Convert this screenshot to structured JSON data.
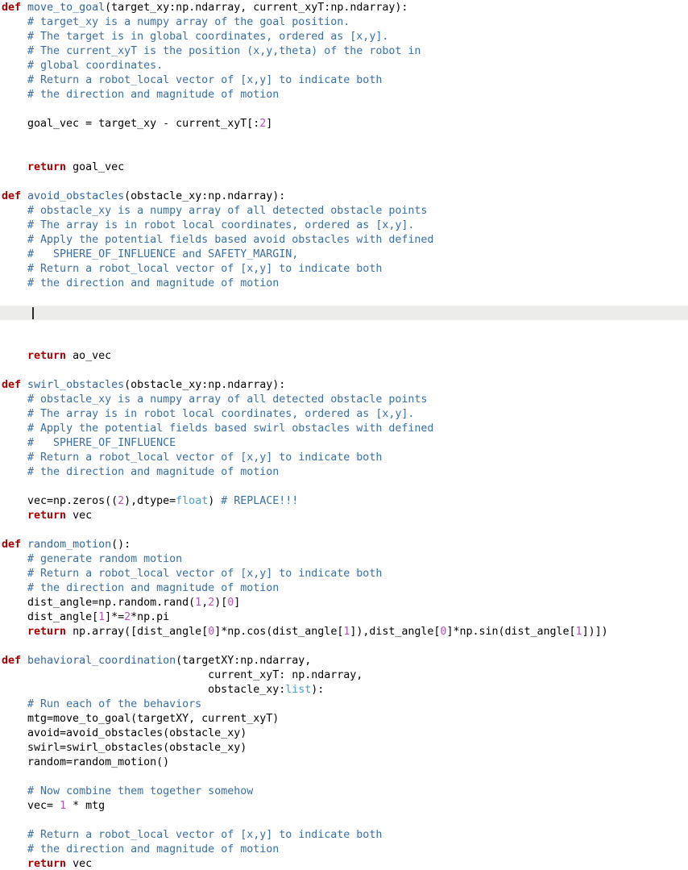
{
  "editor": {
    "name": "python-code-editor",
    "background_color": "#ffffff",
    "current_line_highlight_color": "#ececea",
    "caret_color": "#2b2b2b",
    "font_size_px": 13.3,
    "line_height_px": 18,
    "language": "python"
  },
  "colors": {
    "keyword": "#aa0000",
    "function_name": "#3465a4",
    "builtin_type": "#4e9bd6",
    "number": "#b452b4",
    "comment": "#3b6ea5",
    "plain": "#000000"
  },
  "caret": {
    "line_index": 21,
    "column": 4
  },
  "lines": [
    {
      "i": 0,
      "tokens": [
        {
          "t": "def",
          "c": "kw"
        },
        {
          "t": " ",
          "c": "plain"
        },
        {
          "t": "move_to_goal",
          "c": "fn"
        },
        {
          "t": "(target_xy:np.ndarray, current_xyT:np.ndarray):",
          "c": "plain"
        }
      ]
    },
    {
      "i": 1,
      "tokens": [
        {
          "t": "    ",
          "c": "plain"
        },
        {
          "t": "# target_xy is a numpy array of the goal position.",
          "c": "com"
        }
      ]
    },
    {
      "i": 2,
      "tokens": [
        {
          "t": "    ",
          "c": "plain"
        },
        {
          "t": "# The target is in global coordinates, ordered as [x,y].",
          "c": "com"
        }
      ]
    },
    {
      "i": 3,
      "tokens": [
        {
          "t": "    ",
          "c": "plain"
        },
        {
          "t": "# The current_xyT is the position (x,y,theta) of the robot in",
          "c": "com"
        }
      ]
    },
    {
      "i": 4,
      "tokens": [
        {
          "t": "    ",
          "c": "plain"
        },
        {
          "t": "# global coordinates.",
          "c": "com"
        }
      ]
    },
    {
      "i": 5,
      "tokens": [
        {
          "t": "    ",
          "c": "plain"
        },
        {
          "t": "# Return a robot_local vector of [x,y] to indicate both",
          "c": "com"
        }
      ]
    },
    {
      "i": 6,
      "tokens": [
        {
          "t": "    ",
          "c": "plain"
        },
        {
          "t": "# the direction and magnitude of motion",
          "c": "com"
        }
      ]
    },
    {
      "i": 7,
      "tokens": []
    },
    {
      "i": 8,
      "tokens": [
        {
          "t": "    goal_vec = target_xy - current_xyT[:",
          "c": "plain"
        },
        {
          "t": "2",
          "c": "num"
        },
        {
          "t": "]",
          "c": "plain"
        }
      ]
    },
    {
      "i": 9,
      "tokens": []
    },
    {
      "i": 10,
      "tokens": []
    },
    {
      "i": 11,
      "tokens": [
        {
          "t": "    ",
          "c": "plain"
        },
        {
          "t": "return",
          "c": "kw"
        },
        {
          "t": " goal_vec",
          "c": "plain"
        }
      ]
    },
    {
      "i": 12,
      "tokens": []
    },
    {
      "i": 13,
      "tokens": [
        {
          "t": "def",
          "c": "kw"
        },
        {
          "t": " ",
          "c": "plain"
        },
        {
          "t": "avoid_obstacles",
          "c": "fn"
        },
        {
          "t": "(obstacle_xy:np.ndarray):",
          "c": "plain"
        }
      ]
    },
    {
      "i": 14,
      "tokens": [
        {
          "t": "    ",
          "c": "plain"
        },
        {
          "t": "# obstacle_xy is a numpy array of all detected obstacle points",
          "c": "com"
        }
      ]
    },
    {
      "i": 15,
      "tokens": [
        {
          "t": "    ",
          "c": "plain"
        },
        {
          "t": "# The array is in robot local coordinates, ordered as [x,y].",
          "c": "com"
        }
      ]
    },
    {
      "i": 16,
      "tokens": [
        {
          "t": "    ",
          "c": "plain"
        },
        {
          "t": "# Apply the potential fields based avoid obstacles with defined",
          "c": "com"
        }
      ]
    },
    {
      "i": 17,
      "tokens": [
        {
          "t": "    ",
          "c": "plain"
        },
        {
          "t": "#   SPHERE_OF_INFLUENCE and SAFETY_MARGIN,",
          "c": "com"
        }
      ]
    },
    {
      "i": 18,
      "tokens": [
        {
          "t": "    ",
          "c": "plain"
        },
        {
          "t": "# Return a robot_local vector of [x,y] to indicate both",
          "c": "com"
        }
      ]
    },
    {
      "i": 19,
      "tokens": [
        {
          "t": "    ",
          "c": "plain"
        },
        {
          "t": "# the direction and magnitude of motion",
          "c": "com"
        }
      ]
    },
    {
      "i": 20,
      "tokens": []
    },
    {
      "i": 21,
      "tokens": [
        {
          "t": "    ",
          "c": "plain"
        }
      ],
      "current": true
    },
    {
      "i": 22,
      "tokens": []
    },
    {
      "i": 23,
      "tokens": []
    },
    {
      "i": 24,
      "tokens": [
        {
          "t": "    ",
          "c": "plain"
        },
        {
          "t": "return",
          "c": "kw"
        },
        {
          "t": " ao_vec",
          "c": "plain"
        }
      ]
    },
    {
      "i": 25,
      "tokens": []
    },
    {
      "i": 26,
      "tokens": [
        {
          "t": "def",
          "c": "kw"
        },
        {
          "t": " ",
          "c": "plain"
        },
        {
          "t": "swirl_obstacles",
          "c": "fn"
        },
        {
          "t": "(obstacle_xy:np.ndarray):",
          "c": "plain"
        }
      ]
    },
    {
      "i": 27,
      "tokens": [
        {
          "t": "    ",
          "c": "plain"
        },
        {
          "t": "# obstacle_xy is a numpy array of all detected obstacle points",
          "c": "com"
        }
      ]
    },
    {
      "i": 28,
      "tokens": [
        {
          "t": "    ",
          "c": "plain"
        },
        {
          "t": "# The array is in robot local coordinates, ordered as [x,y].",
          "c": "com"
        }
      ]
    },
    {
      "i": 29,
      "tokens": [
        {
          "t": "    ",
          "c": "plain"
        },
        {
          "t": "# Apply the potential fields based swirl obstacles with defined",
          "c": "com"
        }
      ]
    },
    {
      "i": 30,
      "tokens": [
        {
          "t": "    ",
          "c": "plain"
        },
        {
          "t": "#   SPHERE_OF_INFLUENCE",
          "c": "com"
        }
      ]
    },
    {
      "i": 31,
      "tokens": [
        {
          "t": "    ",
          "c": "plain"
        },
        {
          "t": "# Return a robot_local vector of [x,y] to indicate both",
          "c": "com"
        }
      ]
    },
    {
      "i": 32,
      "tokens": [
        {
          "t": "    ",
          "c": "plain"
        },
        {
          "t": "# the direction and magnitude of motion",
          "c": "com"
        }
      ]
    },
    {
      "i": 33,
      "tokens": []
    },
    {
      "i": 34,
      "tokens": [
        {
          "t": "    vec=np.zeros((",
          "c": "plain"
        },
        {
          "t": "2",
          "c": "num"
        },
        {
          "t": "),dtype=",
          "c": "plain"
        },
        {
          "t": "float",
          "c": "builtin"
        },
        {
          "t": ") ",
          "c": "plain"
        },
        {
          "t": "# REPLACE!!!",
          "c": "com"
        }
      ]
    },
    {
      "i": 35,
      "tokens": [
        {
          "t": "    ",
          "c": "plain"
        },
        {
          "t": "return",
          "c": "kw"
        },
        {
          "t": " vec",
          "c": "plain"
        }
      ]
    },
    {
      "i": 36,
      "tokens": []
    },
    {
      "i": 37,
      "tokens": [
        {
          "t": "def",
          "c": "kw"
        },
        {
          "t": " ",
          "c": "plain"
        },
        {
          "t": "random_motion",
          "c": "fn"
        },
        {
          "t": "():",
          "c": "plain"
        }
      ]
    },
    {
      "i": 38,
      "tokens": [
        {
          "t": "    ",
          "c": "plain"
        },
        {
          "t": "# generate random motion",
          "c": "com"
        }
      ]
    },
    {
      "i": 39,
      "tokens": [
        {
          "t": "    ",
          "c": "plain"
        },
        {
          "t": "# Return a robot_local vector of [x,y] to indicate both",
          "c": "com"
        }
      ]
    },
    {
      "i": 40,
      "tokens": [
        {
          "t": "    ",
          "c": "plain"
        },
        {
          "t": "# the direction and magnitude of motion",
          "c": "com"
        }
      ]
    },
    {
      "i": 41,
      "tokens": [
        {
          "t": "    dist_angle=np.random.rand(",
          "c": "plain"
        },
        {
          "t": "1",
          "c": "num"
        },
        {
          "t": ",",
          "c": "plain"
        },
        {
          "t": "2",
          "c": "num"
        },
        {
          "t": ")[",
          "c": "plain"
        },
        {
          "t": "0",
          "c": "num"
        },
        {
          "t": "]",
          "c": "plain"
        }
      ]
    },
    {
      "i": 42,
      "tokens": [
        {
          "t": "    dist_angle[",
          "c": "plain"
        },
        {
          "t": "1",
          "c": "num"
        },
        {
          "t": "]*=",
          "c": "plain"
        },
        {
          "t": "2",
          "c": "num"
        },
        {
          "t": "*np.pi",
          "c": "plain"
        }
      ]
    },
    {
      "i": 43,
      "tokens": [
        {
          "t": "    ",
          "c": "plain"
        },
        {
          "t": "return",
          "c": "kw"
        },
        {
          "t": " np.array([dist_angle[",
          "c": "plain"
        },
        {
          "t": "0",
          "c": "num"
        },
        {
          "t": "]*np.cos(dist_angle[",
          "c": "plain"
        },
        {
          "t": "1",
          "c": "num"
        },
        {
          "t": "]),dist_angle[",
          "c": "plain"
        },
        {
          "t": "0",
          "c": "num"
        },
        {
          "t": "]*np.sin(dist_angle[",
          "c": "plain"
        },
        {
          "t": "1",
          "c": "num"
        },
        {
          "t": "])])",
          "c": "plain"
        }
      ]
    },
    {
      "i": 44,
      "tokens": []
    },
    {
      "i": 45,
      "tokens": [
        {
          "t": "def",
          "c": "kw"
        },
        {
          "t": " ",
          "c": "plain"
        },
        {
          "t": "behavioral_coordination",
          "c": "fn"
        },
        {
          "t": "(targetXY:np.ndarray,",
          "c": "plain"
        }
      ]
    },
    {
      "i": 46,
      "tokens": [
        {
          "t": "                                current_xyT: np.ndarray,",
          "c": "plain"
        }
      ]
    },
    {
      "i": 47,
      "tokens": [
        {
          "t": "                                obstacle_xy:",
          "c": "plain"
        },
        {
          "t": "list",
          "c": "builtin"
        },
        {
          "t": "):",
          "c": "plain"
        }
      ]
    },
    {
      "i": 48,
      "tokens": [
        {
          "t": "    ",
          "c": "plain"
        },
        {
          "t": "# Run each of the behaviors",
          "c": "com"
        }
      ]
    },
    {
      "i": 49,
      "tokens": [
        {
          "t": "    mtg=move_to_goal(targetXY, current_xyT)",
          "c": "plain"
        }
      ]
    },
    {
      "i": 50,
      "tokens": [
        {
          "t": "    avoid=avoid_obstacles(obstacle_xy)",
          "c": "plain"
        }
      ]
    },
    {
      "i": 51,
      "tokens": [
        {
          "t": "    swirl=swirl_obstacles(obstacle_xy)",
          "c": "plain"
        }
      ]
    },
    {
      "i": 52,
      "tokens": [
        {
          "t": "    random=random_motion()",
          "c": "plain"
        }
      ]
    },
    {
      "i": 53,
      "tokens": []
    },
    {
      "i": 54,
      "tokens": [
        {
          "t": "    ",
          "c": "plain"
        },
        {
          "t": "# Now combine them together somehow",
          "c": "com"
        }
      ]
    },
    {
      "i": 55,
      "tokens": [
        {
          "t": "    vec= ",
          "c": "plain"
        },
        {
          "t": "1",
          "c": "num"
        },
        {
          "t": " * mtg",
          "c": "plain"
        }
      ]
    },
    {
      "i": 56,
      "tokens": []
    },
    {
      "i": 57,
      "tokens": [
        {
          "t": "    ",
          "c": "plain"
        },
        {
          "t": "# Return a robot_local vector of [x,y] to indicate both",
          "c": "com"
        }
      ]
    },
    {
      "i": 58,
      "tokens": [
        {
          "t": "    ",
          "c": "plain"
        },
        {
          "t": "# the direction and magnitude of motion",
          "c": "com"
        }
      ]
    },
    {
      "i": 59,
      "tokens": [
        {
          "t": "    ",
          "c": "plain"
        },
        {
          "t": "return",
          "c": "kw"
        },
        {
          "t": " vec",
          "c": "plain"
        }
      ]
    }
  ]
}
